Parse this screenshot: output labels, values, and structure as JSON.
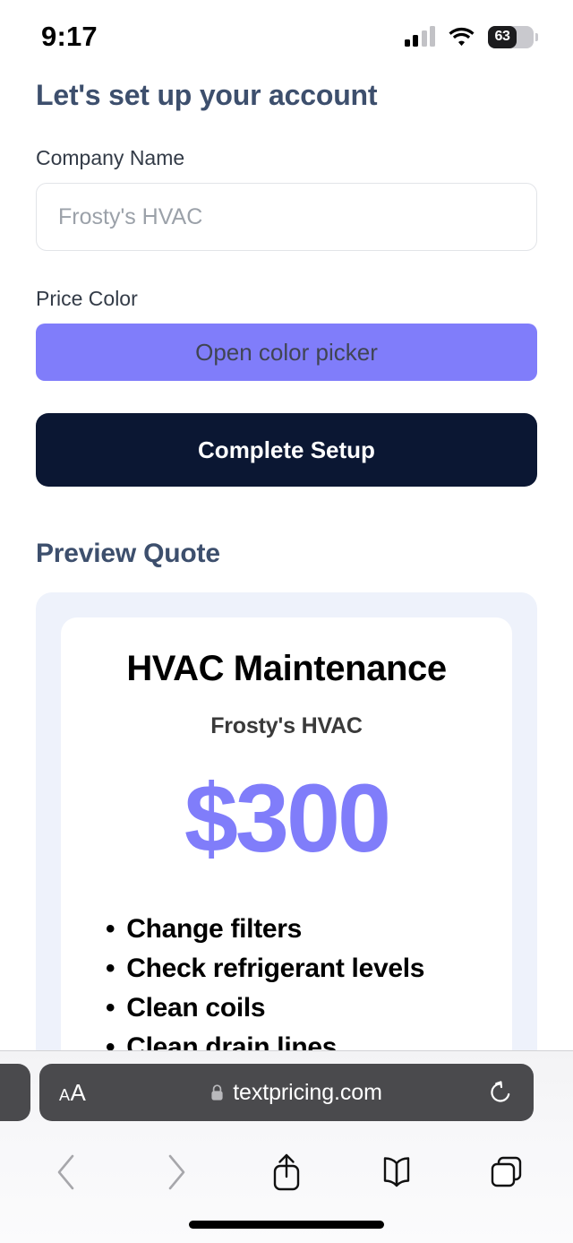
{
  "status_bar": {
    "time": "9:17",
    "signal_icon": "cellular-signal-icon",
    "wifi_icon": "wifi-icon",
    "battery_percent": "63",
    "battery_level": 63
  },
  "page": {
    "title": "Let's set up your account",
    "company_field": {
      "label": "Company Name",
      "placeholder": "Frosty's HVAC",
      "value": ""
    },
    "price_color_field": {
      "label": "Price Color",
      "button_label": "Open color picker",
      "color": "#807dfa"
    },
    "submit_label": "Complete Setup",
    "preview_heading": "Preview Quote",
    "quote": {
      "title": "HVAC Maintenance",
      "company": "Frosty's HVAC",
      "price": "$300",
      "items": [
        "Change filters",
        "Check refrigerant levels",
        "Clean coils",
        "Clean drain lines"
      ]
    }
  },
  "browser": {
    "text_size_small": "A",
    "text_size_large": "A",
    "lock_icon": "lock-icon",
    "url": "textpricing.com",
    "reload_icon": "reload-icon",
    "toolbar": {
      "back_icon": "chevron-left-icon",
      "forward_icon": "chevron-right-icon",
      "share_icon": "share-icon",
      "bookmarks_icon": "book-icon",
      "tabs_icon": "tabs-icon"
    }
  },
  "colors": {
    "accent_purple": "#807dfa",
    "heading_slate": "#3d4f6d",
    "primary_navy": "#0b1733",
    "panel_bg": "#eef2fb"
  }
}
